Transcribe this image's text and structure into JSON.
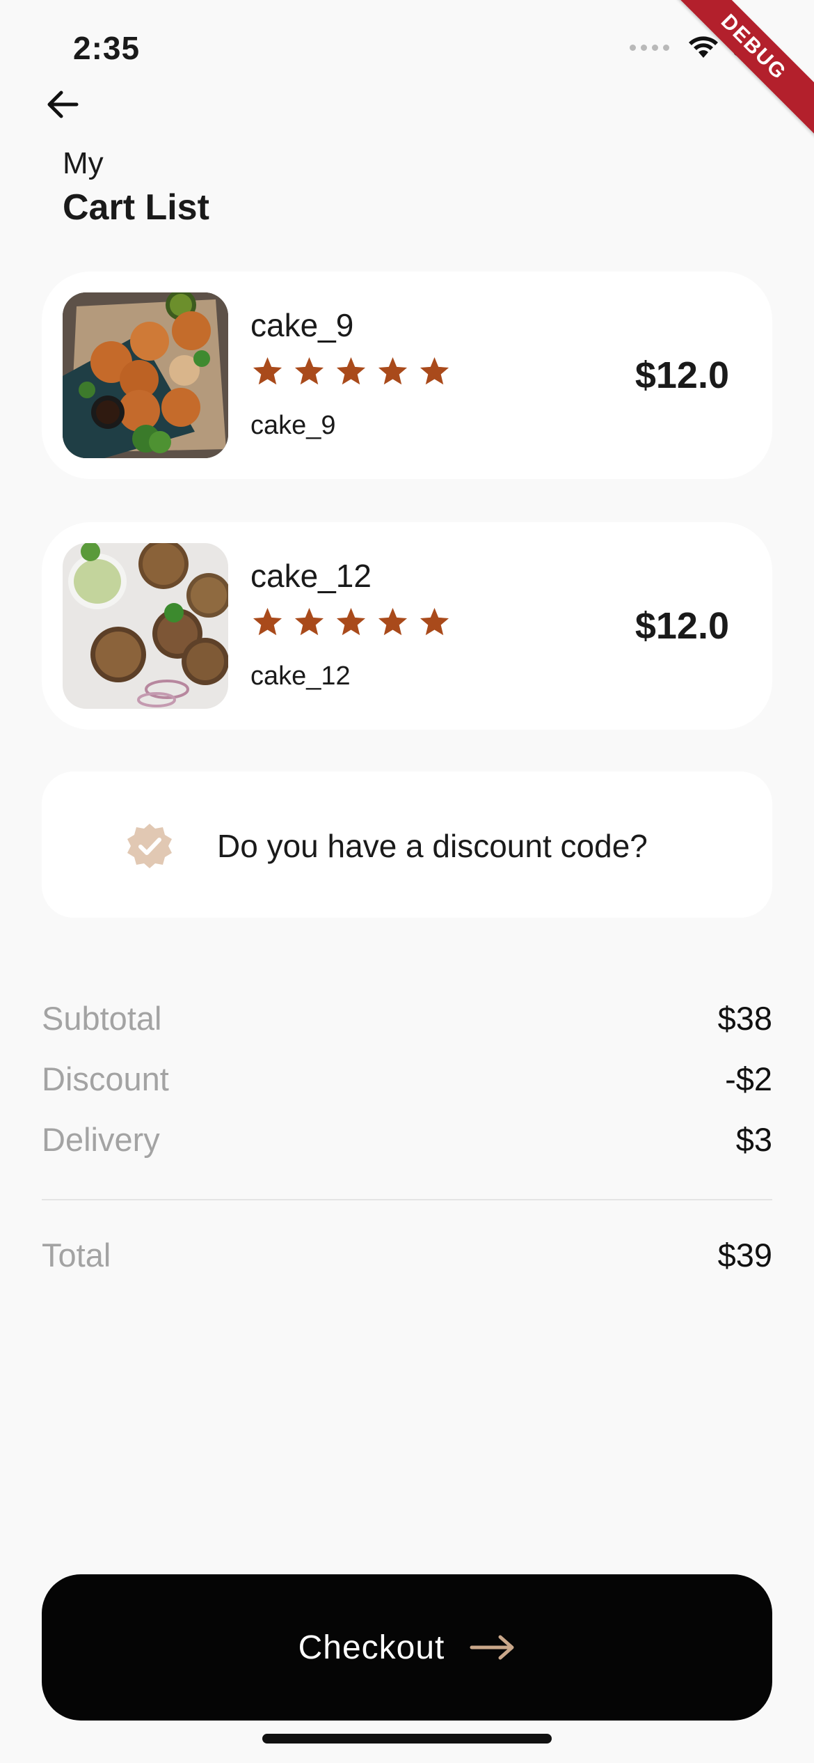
{
  "status_bar": {
    "time": "2:35",
    "debug_label": "DEBUG"
  },
  "header": {
    "subtitle": "My",
    "title": "Cart List"
  },
  "cart": {
    "items": [
      {
        "name": "cake_9",
        "subtitle": "cake_9",
        "price": "$12.0",
        "rating": 5,
        "thumb_icon": "fried-cutlets-photo"
      },
      {
        "name": "cake_12",
        "subtitle": "cake_12",
        "price": "$12.0",
        "rating": 5,
        "thumb_icon": "patties-with-chutney-photo"
      }
    ]
  },
  "discount": {
    "prompt": "Do you have a discount code?",
    "icon": "verified-badge-icon"
  },
  "summary": {
    "subtotal_label": "Subtotal",
    "subtotal_value": "$38",
    "discount_label": "Discount",
    "discount_value": "-$2",
    "delivery_label": "Delivery",
    "delivery_value": "$3",
    "total_label": "Total",
    "total_value": "$39"
  },
  "checkout": {
    "label": "Checkout"
  },
  "colors": {
    "star": "#a94a1b",
    "badge": "#e1c8b3",
    "arrow": "#c9a78a",
    "button": "#050505"
  }
}
